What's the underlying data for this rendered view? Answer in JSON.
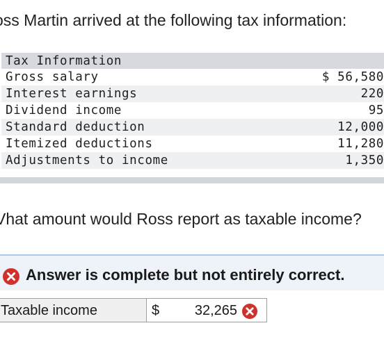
{
  "intro": "oss Martin arrived at the following tax information:",
  "table": {
    "header": "Tax Information",
    "rows": [
      {
        "label": "Gross salary",
        "value": "$ 56,580"
      },
      {
        "label": "Interest earnings",
        "value": "220"
      },
      {
        "label": "Dividend income",
        "value": "95"
      },
      {
        "label": "Standard deduction",
        "value": "12,000"
      },
      {
        "label": "Itemized deductions",
        "value": "11,280"
      },
      {
        "label": "Adjustments to income",
        "value": "1,350"
      }
    ]
  },
  "question": "Vhat amount would Ross report as taxable income?",
  "status": {
    "icon": "x-circle-icon",
    "text": "Answer is complete but not entirely correct.",
    "color": "#d0312d"
  },
  "answer": {
    "label": "Taxable income",
    "currency": "$",
    "value": "32,265",
    "icon": "x-circle-icon"
  }
}
